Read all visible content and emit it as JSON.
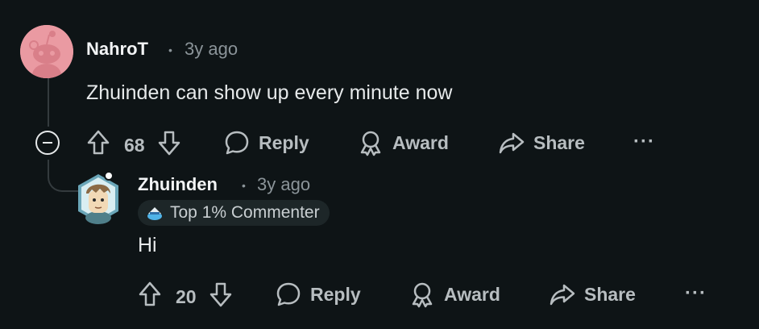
{
  "comments": [
    {
      "username": "NahroT",
      "time": "3y ago",
      "body": "Zhuinden can show up every minute now",
      "votes": "68",
      "actions": {
        "reply": "Reply",
        "award": "Award",
        "share": "Share",
        "more": "···"
      },
      "avatar_color": "#ea9aa2"
    },
    {
      "username": "Zhuinden",
      "time": "3y ago",
      "badge": "Top 1% Commenter",
      "body": "Hi",
      "votes": "20",
      "actions": {
        "reply": "Reply",
        "award": "Award",
        "share": "Share",
        "more": "···"
      }
    }
  ],
  "colors": {
    "background": "#0e1416",
    "muted": "#8b9499",
    "action": "#b7bdc0"
  }
}
